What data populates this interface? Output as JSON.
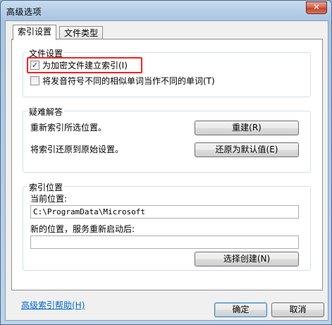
{
  "window": {
    "title": "高级选项",
    "close_glyph": "✕"
  },
  "tabs": [
    {
      "label": "索引设置"
    },
    {
      "label": "文件类型"
    }
  ],
  "file_settings": {
    "legend": "文件设置",
    "encrypt_label": "为加密文件建立索引(I)",
    "encrypt_checked": true,
    "diacritics_label": "将发音符号不同的相似单词当作不同的单词(T)",
    "diacritics_checked": false,
    "check_glyph": "✓"
  },
  "troubleshoot": {
    "legend": "疑难解答",
    "rebuild_text": "重新索引所选位置。",
    "rebuild_button": "重建(R)",
    "restore_text": "将索引还原到原始设置。",
    "restore_button": "还原为默认值(E)"
  },
  "index_location": {
    "legend": "索引位置",
    "current_label": "当前位置:",
    "current_value": "C:\\ProgramData\\Microsoft",
    "new_label": "新的位置，服务重新启动后:",
    "new_value": "",
    "select_button": "选择创建(N)"
  },
  "help_link": "高级索引帮助(H)",
  "footer": {
    "ok": "确定",
    "cancel": "取消"
  }
}
